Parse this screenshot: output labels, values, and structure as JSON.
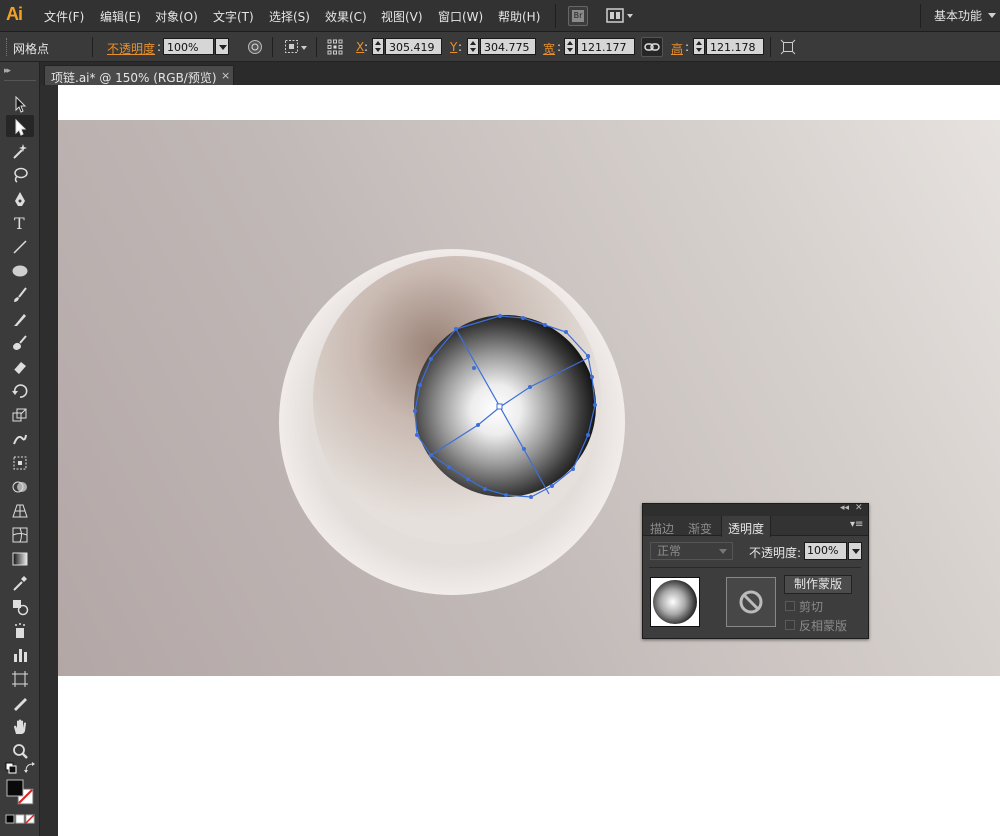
{
  "app": {
    "logo": "Ai"
  },
  "menu": [
    {
      "label": "文件(F)"
    },
    {
      "label": "编辑(E)"
    },
    {
      "label": "对象(O)"
    },
    {
      "label": "文字(T)"
    },
    {
      "label": "选择(S)"
    },
    {
      "label": "效果(C)"
    },
    {
      "label": "视图(V)"
    },
    {
      "label": "窗口(W)"
    },
    {
      "label": "帮助(H)"
    }
  ],
  "bridge_label": "Br",
  "workspace": "基本功能",
  "control": {
    "selection_type": "网格点",
    "opacity_label": "不透明度",
    "opacity_colon": ":",
    "opacity_value": "100%",
    "x_label": "X",
    "x_value": "305.419",
    "y_label": "Y",
    "y_value": "304.775",
    "w_label": "宽",
    "w_value": "121.177",
    "h_label": "高",
    "h_value": "121.178",
    "colon": ":"
  },
  "document_tab": {
    "title": "项链.ai* @ 150% (RGB/预览)",
    "close": "×"
  },
  "transparency_panel": {
    "tabs": [
      {
        "label": "描边"
      },
      {
        "label": "渐变"
      },
      {
        "label": "透明度"
      }
    ],
    "blend_mode": "正常",
    "opacity_label": "不透明度:",
    "opacity_value": "100%",
    "make_mask_label": "制作蒙版",
    "clip_label": "剪切",
    "invert_mask_label": "反相蒙版"
  },
  "colors": {
    "accent_orange": "#e8902c",
    "selection_blue": "#3d6fd8",
    "ui_dark": "#3a3a3a"
  },
  "icons": [
    "selection-tool-icon",
    "direct-selection-tool-icon",
    "magic-wand-icon",
    "lasso-icon",
    "pen-tool-icon",
    "type-tool-icon",
    "line-tool-icon",
    "ellipse-tool-icon",
    "paintbrush-icon",
    "pencil-icon",
    "blob-brush-icon",
    "eraser-icon",
    "rotate-tool-icon",
    "scale-tool-icon",
    "warp-tool-icon",
    "free-transform-icon",
    "shape-builder-icon",
    "perspective-grid-icon",
    "mesh-tool-icon",
    "gradient-tool-icon",
    "eyedropper-icon",
    "blend-tool-icon",
    "symbol-sprayer-icon",
    "column-graph-icon",
    "artboard-tool-icon",
    "slice-tool-icon",
    "hand-tool-icon",
    "zoom-tool-icon"
  ]
}
